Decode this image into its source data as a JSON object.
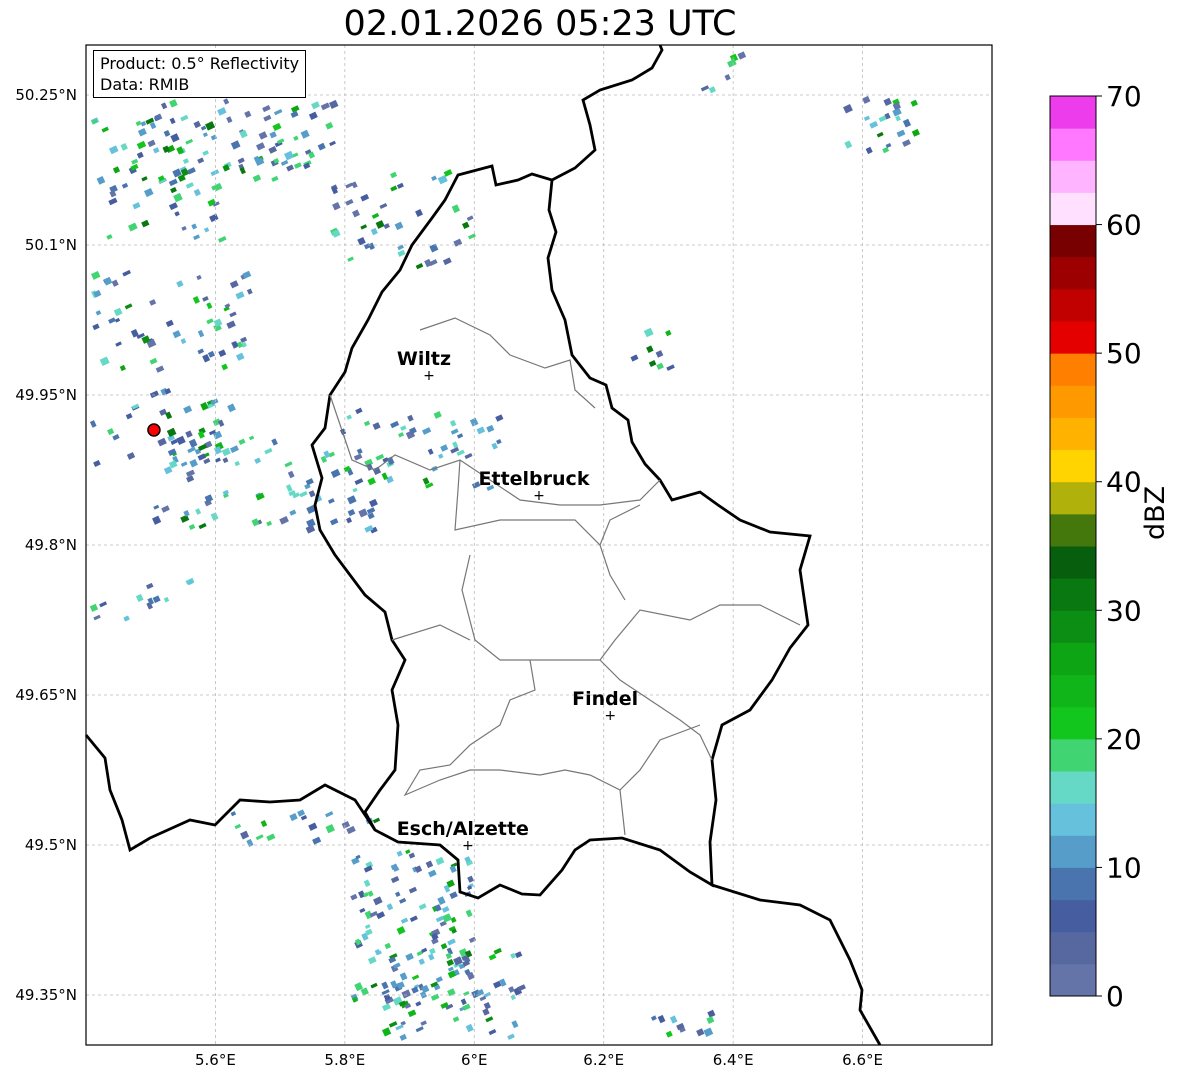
{
  "title": "02.01.2026 05:23 UTC",
  "info_box": {
    "product": "Product: 0.5° Reflectivity",
    "data": "Data: RMIB"
  },
  "axes": {
    "lat_ticks": [
      "50.25°N",
      "50.1°N",
      "49.95°N",
      "49.8°N",
      "49.65°N",
      "49.5°N",
      "49.35°N"
    ],
    "lon_ticks": [
      "5.6°E",
      "5.8°E",
      "6°E",
      "6.2°E",
      "6.4°E",
      "6.6°E"
    ],
    "lat_values": [
      50.25,
      50.1,
      49.95,
      49.8,
      49.65,
      49.5,
      49.35
    ],
    "lon_values": [
      5.6,
      5.8,
      6.0,
      6.2,
      6.4,
      6.6
    ],
    "lon_range": [
      5.4,
      6.8
    ],
    "lat_range": [
      49.3,
      50.3
    ],
    "grid": true
  },
  "cities": [
    {
      "name": "Wiltz",
      "lon": 5.93,
      "lat": 49.97
    },
    {
      "name": "Ettelbruck",
      "lon": 6.1,
      "lat": 49.85
    },
    {
      "name": "Findel",
      "lon": 6.21,
      "lat": 49.63
    },
    {
      "name": "Esch/Alzette",
      "lon": 5.99,
      "lat": 49.5
    }
  ],
  "radar_site": {
    "lon": 5.505,
    "lat": 49.915,
    "color": "#ff0000"
  },
  "colorbar": {
    "label": "dBZ",
    "ticks": [
      "0",
      "10",
      "20",
      "30",
      "40",
      "50",
      "60",
      "70"
    ],
    "range": [
      0,
      70
    ],
    "colors": [
      "#6474a8",
      "#56689f",
      "#465e9f",
      "#4a74ae",
      "#569ec9",
      "#66c2dc",
      "#66d9c6",
      "#40d472",
      "#12c61e",
      "#10b51a",
      "#0ea514",
      "#0b8e13",
      "#0a7810",
      "#075e0d",
      "#45780c",
      "#b1b10b",
      "#ffd400",
      "#ffb200",
      "#ff9900",
      "#ff7f00",
      "#e50000",
      "#c10000",
      "#9d0000",
      "#790000",
      "#ffe1ff",
      "#ffb4ff",
      "#ff78ff",
      "#ec3cec"
    ]
  }
}
